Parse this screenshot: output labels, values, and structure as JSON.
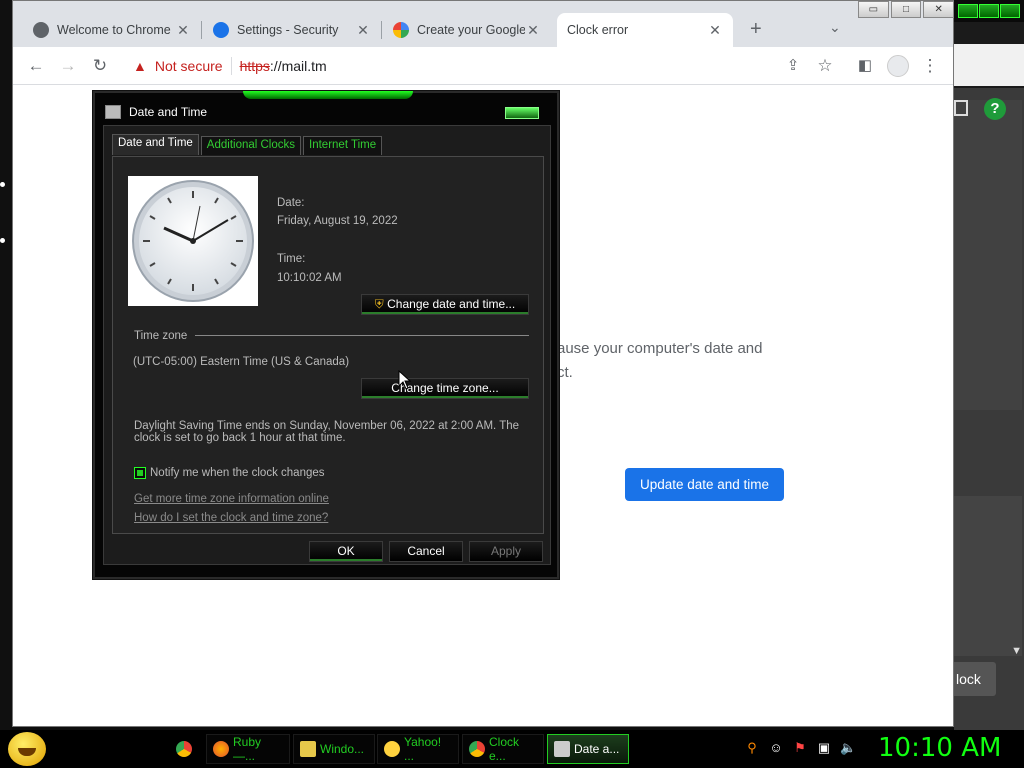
{
  "browser": {
    "tabs": [
      {
        "title": "Welcome to Chrome",
        "active": false
      },
      {
        "title": "Settings - Security",
        "active": false
      },
      {
        "title": "Create your Google A",
        "active": false
      },
      {
        "title": "Clock error",
        "active": true
      }
    ],
    "new_tab_glyph": "+",
    "tab_search_glyph": "⌄",
    "close_glyph": "✕",
    "window_controls": {
      "minimize": "▭",
      "maximize": "□",
      "close": "✕"
    },
    "security_label": "Not secure",
    "url_scheme": "https",
    "url_rest": "://mail.tm"
  },
  "page": {
    "body_line1": "ause your computer's date and",
    "body_line2": "ct.",
    "update_button": "Update date and time"
  },
  "dialog": {
    "title": "Date and Time",
    "tabs": [
      "Date and Time",
      "Additional Clocks",
      "Internet Time"
    ],
    "date_label": "Date:",
    "date_value": "Friday, August 19, 2022",
    "time_label": "Time:",
    "time_value": "10:10:02 AM",
    "change_datetime_button": "Change date and time...",
    "timezone_header": "Time zone",
    "timezone_value": "(UTC-05:00) Eastern Time (US & Canada)",
    "change_timezone_button": "Change time zone...",
    "dst_line1": "Daylight Saving Time ends on Sunday, November 06, 2022 at 2:00 AM. The",
    "dst_line2": "clock is set to go back 1 hour at that time.",
    "notify_label": "Notify me when the clock changes",
    "notify_checked": true,
    "link_more_info": "Get more time zone information online",
    "link_how_set": "How do I set the clock and time zone?",
    "ok": "OK",
    "cancel": "Cancel",
    "apply": "Apply"
  },
  "desktop_right": {
    "clock_button": "lock",
    "help_glyph": "?"
  },
  "taskbar": {
    "items": [
      {
        "label": "Ruby —...",
        "icon": "firefox-icon"
      },
      {
        "label": "Windo...",
        "icon": "folder-icon"
      },
      {
        "label": "Yahoo! ...",
        "icon": "yahoo-icon"
      },
      {
        "label": "Clock e...",
        "icon": "chrome-icon"
      },
      {
        "label": "Date a...",
        "icon": "date-time-icon"
      }
    ],
    "clock": "10:10 AM"
  },
  "colors": {
    "accent_green": "#22cc22",
    "chrome_blue": "#1a73e8",
    "not_secure_red": "#c5221f"
  }
}
